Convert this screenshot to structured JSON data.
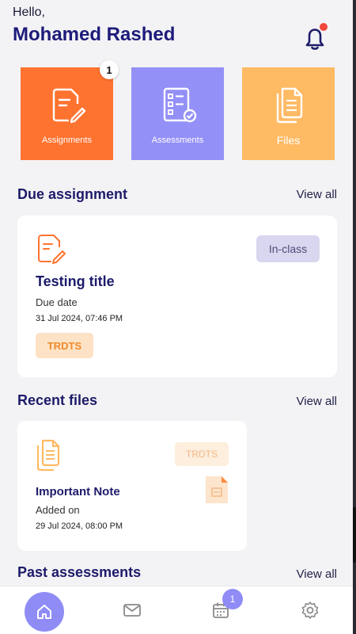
{
  "header": {
    "greeting": "Hello,",
    "user_name": "Mohamed Rashed",
    "notification_dot_color": "#f0473c"
  },
  "tiles": [
    {
      "label": "Assignments",
      "icon": "assignment-edit-icon",
      "color": "#ff7330",
      "badge": "1"
    },
    {
      "label": "Assessments",
      "icon": "checklist-icon",
      "color": "#9390f7"
    },
    {
      "label": "Files",
      "icon": "files-icon",
      "color": "#ffba64"
    }
  ],
  "due_section": {
    "title": "Due assignment",
    "view_all": "View all",
    "card": {
      "type_badge": "In-class",
      "title": "Testing title",
      "due_label": "Due date",
      "due_date": "31 Jul 2024, 07:46 PM",
      "tag": "TRDTS"
    }
  },
  "files_section": {
    "title": "Recent files",
    "view_all": "View all",
    "card": {
      "tag": "TRDTS",
      "title": "Important Note",
      "added_label": "Added on",
      "added_date": "29 Jul 2024, 08:00 PM"
    }
  },
  "past_section": {
    "title": "Past assessments",
    "view_all": "View all"
  },
  "bottom_nav": {
    "active": "home",
    "items": [
      "home-icon",
      "mail-icon",
      "calendar-icon",
      "settings-icon"
    ],
    "calendar_badge": "1",
    "accent": "#8f8cf6"
  }
}
